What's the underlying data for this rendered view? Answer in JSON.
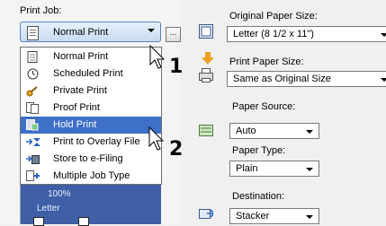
{
  "print_job": {
    "label": "Print Job:",
    "selected": "Normal Print",
    "more_button": "..."
  },
  "job_menu": {
    "items": [
      {
        "label": "Normal Print",
        "icon": "document-icon"
      },
      {
        "label": "Scheduled Print",
        "icon": "clock-icon"
      },
      {
        "label": "Private Print",
        "icon": "key-icon"
      },
      {
        "label": "Proof Print",
        "icon": "proof-icon"
      },
      {
        "label": "Hold Print",
        "icon": "hold-icon"
      },
      {
        "label": "Print to Overlay File",
        "icon": "overlay-icon"
      },
      {
        "label": "Store to e-Filing",
        "icon": "efiling-icon"
      },
      {
        "label": "Multiple Job Type",
        "icon": "multiple-job-icon"
      }
    ],
    "selected_index": 4
  },
  "preview": {
    "zoom": "100%",
    "size": "Letter"
  },
  "callouts": {
    "one": "1",
    "two": "2"
  },
  "original_paper_size": {
    "label": "Original Paper Size:",
    "value": "Letter (8 1/2 x 11\")"
  },
  "print_paper_size": {
    "label": "Print Paper Size:",
    "value": "Same as Original Size"
  },
  "paper_source": {
    "label": "Paper Source:",
    "value": "Auto"
  },
  "paper_type": {
    "label": "Paper Type:",
    "value": "Plain"
  },
  "destination": {
    "label": "Destination:",
    "value": "Stacker"
  },
  "colors": {
    "selection": "#3e6fc9",
    "preview_bg": "#3f5fa6"
  }
}
